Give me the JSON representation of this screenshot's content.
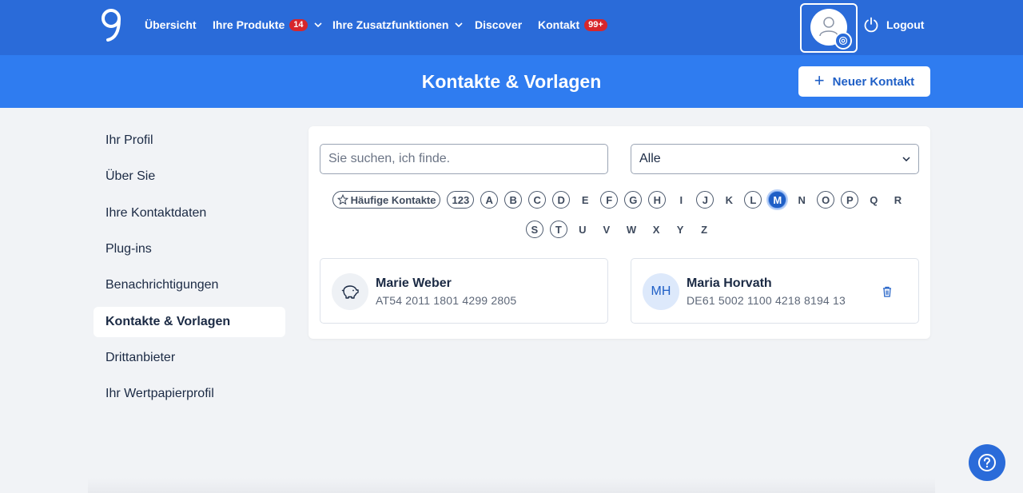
{
  "nav": {
    "items": [
      {
        "label": "Übersicht"
      },
      {
        "label": "Ihre Produkte",
        "badge": "14"
      },
      {
        "label": "Ihre Zusatzfunktionen"
      },
      {
        "label": "Discover"
      },
      {
        "label": "Kontakt",
        "badge": "99+"
      }
    ],
    "logout_label": "Logout",
    "brand_color": "#2a6bd9"
  },
  "header": {
    "title": "Kontakte & Vorlagen",
    "new_contact_label": "Neuer Kontakt",
    "color": "#2f7cf0"
  },
  "sidebar": {
    "items": [
      {
        "label": "Ihr Profil"
      },
      {
        "label": "Über Sie"
      },
      {
        "label": "Ihre Kontaktdaten"
      },
      {
        "label": "Plug-ins"
      },
      {
        "label": "Benachrichtigungen"
      },
      {
        "label": "Kontakte & Vorlagen",
        "active": true
      },
      {
        "label": "Drittanbieter"
      },
      {
        "label": "Ihr Wertpapierprofil"
      }
    ]
  },
  "search": {
    "placeholder": "Sie suchen, ich finde.",
    "value": ""
  },
  "filter": {
    "selected": "Alle"
  },
  "alphabet": {
    "favorites_label": "Häufige Kontakte",
    "numbers_label": "123",
    "active": "M",
    "row1": [
      "A",
      "B",
      "C",
      "D",
      "E",
      "F",
      "G",
      "H",
      "I",
      "J",
      "K",
      "L",
      "M",
      "N",
      "O",
      "P",
      "Q",
      "R"
    ],
    "row2": [
      "S",
      "T",
      "U",
      "V",
      "W",
      "X",
      "Y",
      "Z"
    ],
    "enabled": [
      "A",
      "B",
      "C",
      "D",
      "F",
      "G",
      "H",
      "J",
      "L",
      "M",
      "O",
      "P",
      "S",
      "T"
    ]
  },
  "contacts": [
    {
      "name": "Marie Weber",
      "iban": "AT54 2011 1801 4299 2805",
      "icon": "piggy-bank-icon"
    },
    {
      "name": "Maria Horvath",
      "iban": "DE61 5002 1100 4218 8194 13",
      "initials": "MH",
      "icon": "trash-icon"
    }
  ]
}
